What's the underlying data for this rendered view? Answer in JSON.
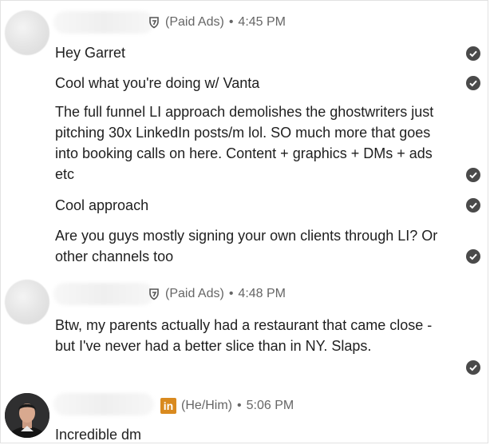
{
  "conversation": {
    "groups": [
      {
        "meta": {
          "tag": "(Paid Ads)",
          "time": "4:45 PM"
        },
        "messages": [
          {
            "text": "Hey Garret"
          },
          {
            "text": "Cool what you're doing w/ Vanta"
          },
          {
            "text": "The full funnel LI approach demolishes the ghostwriters just pitching 30x LinkedIn posts/m lol. SO much more that goes into booking calls on here. Content + graphics + DMs + ads etc"
          },
          {
            "text": "Cool approach"
          },
          {
            "text": "Are you guys mostly signing your own clients through LI? Or other channels too"
          }
        ]
      },
      {
        "meta": {
          "tag": "(Paid Ads)",
          "time": "4:48 PM"
        },
        "messages": [
          {
            "text": "Btw, my parents actually had a restaurant that came close - but I've never had a better slice than in NY. Slaps."
          }
        ]
      },
      {
        "meta": {
          "badge": "in",
          "pronouns": "(He/Him)",
          "time": "5:06 PM"
        },
        "messages": [
          {
            "text": "Incredible dm"
          }
        ]
      }
    ],
    "separator": "•",
    "icons": {
      "read_receipt": "check-circle-icon",
      "premium": "shield-badge-icon",
      "linkedin": "linkedin-badge-icon"
    },
    "colors": {
      "meta_text": "#666666",
      "linkedin_badge": "#d98a1f",
      "check": "#4a4a4a"
    }
  }
}
